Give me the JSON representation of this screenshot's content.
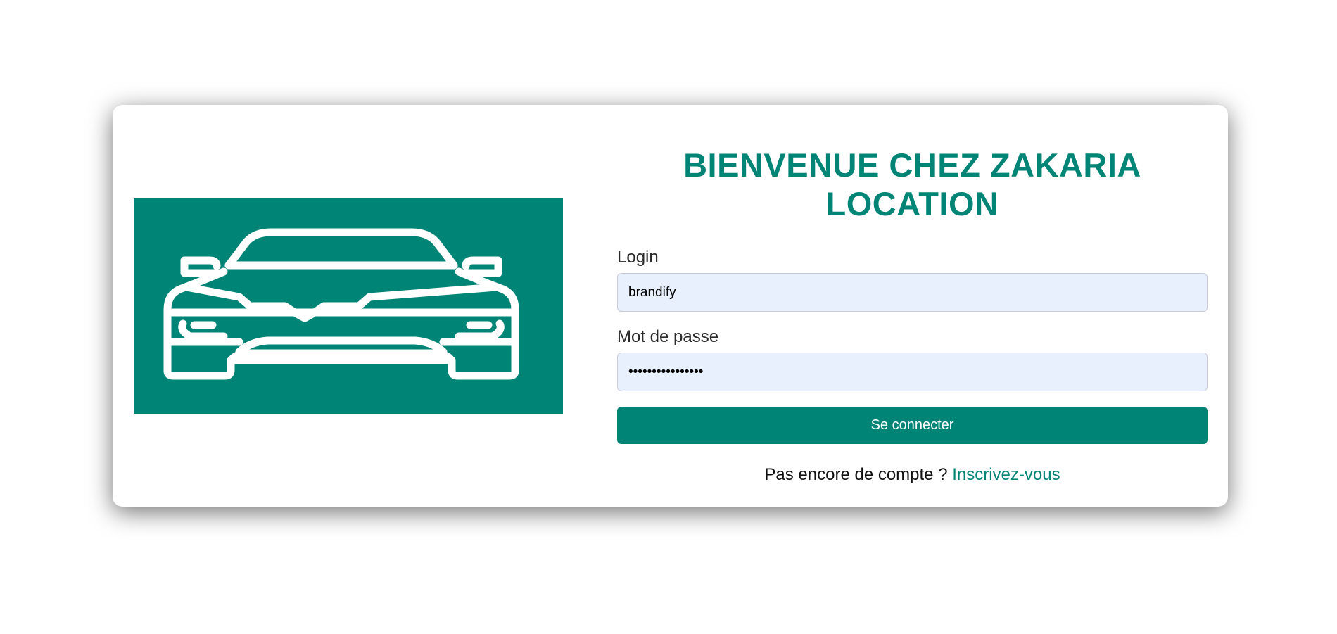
{
  "page": {
    "title": "BIENVENUE CHEZ ZAKARIA LOCATION",
    "accent_color": "#008475",
    "input_background": "#e8f0fe"
  },
  "hero": {
    "icon": "car-front-icon"
  },
  "form": {
    "login_label": "Login",
    "login_value": "brandify",
    "password_label": "Mot de passe",
    "password_value": "brandifybrandify",
    "submit_label": "Se connecter"
  },
  "signup": {
    "prompt": "Pas encore de compte ?",
    "link_label": "Inscrivez-vous"
  }
}
